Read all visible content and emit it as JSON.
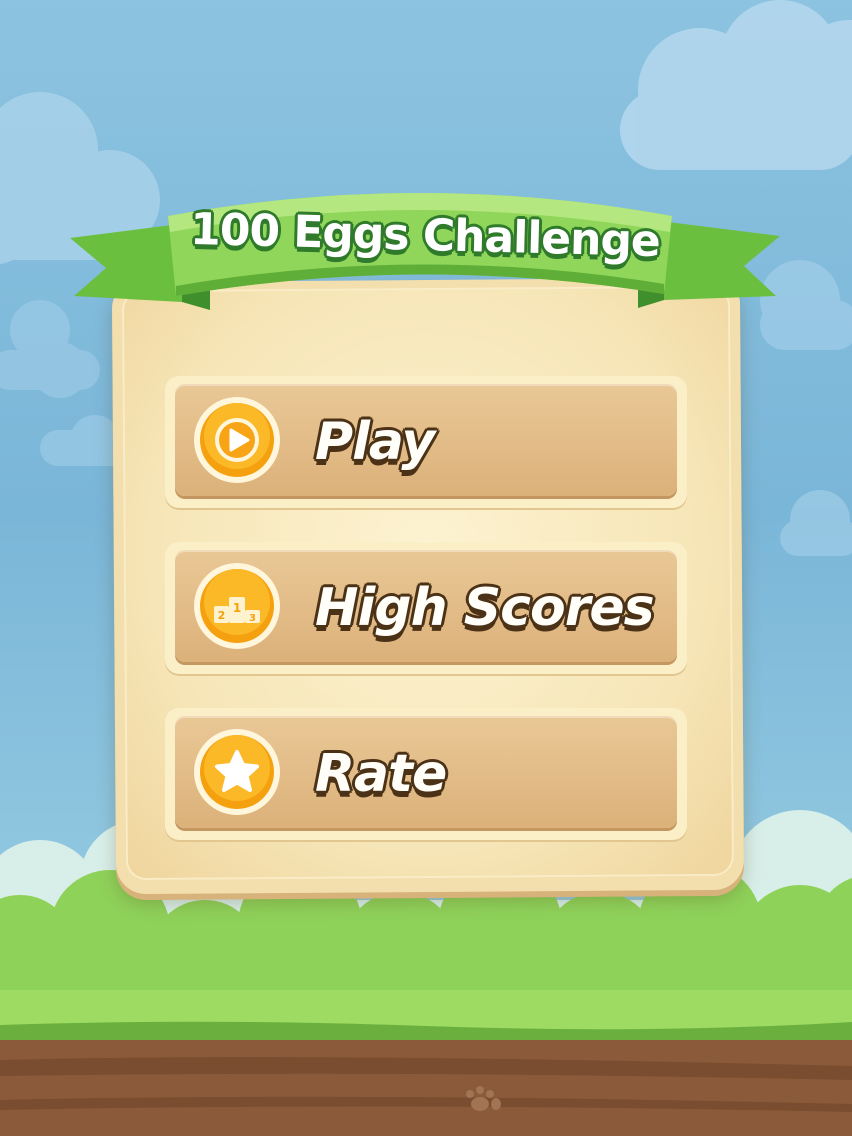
{
  "title": "100 Eggs Challenge",
  "menu": {
    "play_label": "Play",
    "high_scores_label": "High Scores",
    "rate_label": "Rate"
  },
  "icons": {
    "play": "play-triangle-icon",
    "high_scores": "podium-icon",
    "rate": "star-icon"
  },
  "podium_numbers": [
    "2",
    "1",
    "3"
  ],
  "colors": {
    "sky": "#7ab6d8",
    "ribbon_green": "#7cc84a",
    "ribbon_dark": "#2f7a2b",
    "panel": "#f3dfad",
    "button": "#dcb17a",
    "icon_orange": "#f5a00f",
    "label_outline": "#4b3216",
    "grass": "#8fd25a",
    "dirt": "#8a5a3a"
  }
}
